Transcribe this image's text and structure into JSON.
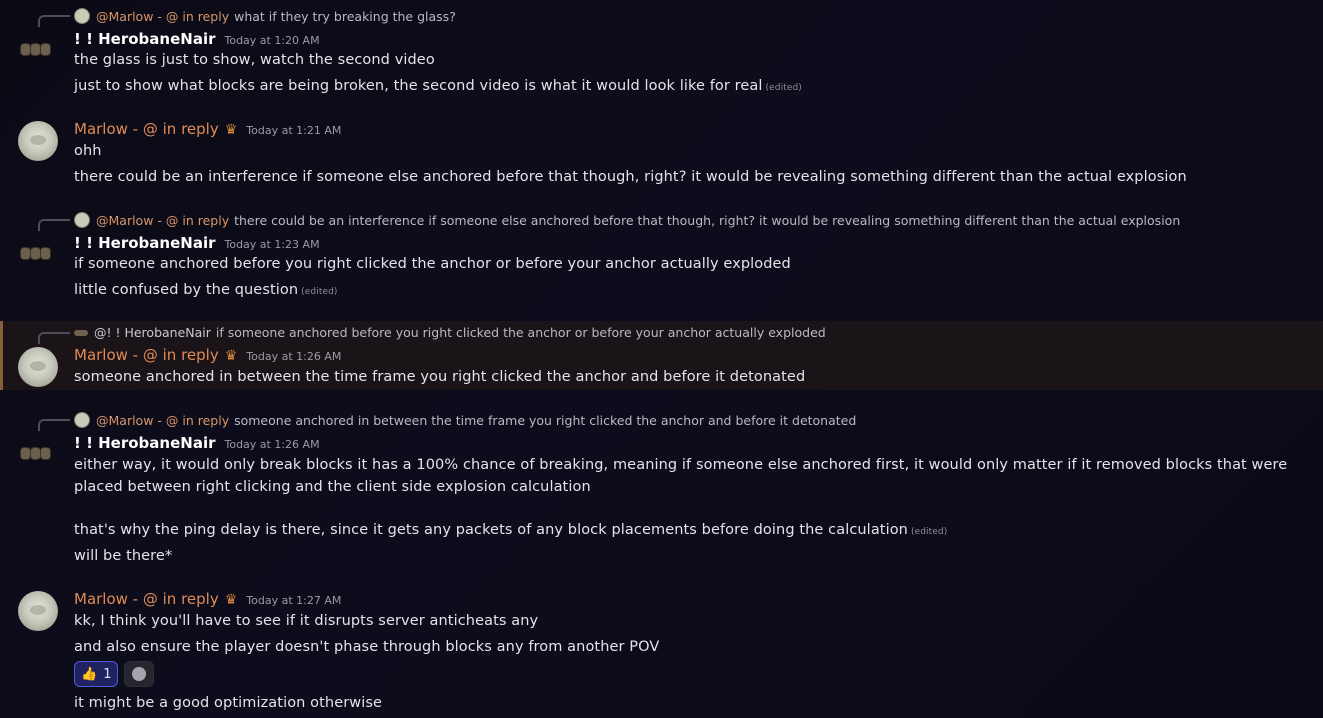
{
  "messages": [
    {
      "reply": {
        "name": "@Marlow - @ in reply",
        "text": "what if they try breaking the glass?"
      },
      "author": "! ! HerobaneNair",
      "time": "Today at 1:20 AM",
      "lines": [
        "the glass is just to show, watch the second video",
        "just to show what blocks are being broken, the second video is what it would look like for real"
      ],
      "edited": "(edited)"
    },
    {
      "author": "Marlow - @ in reply",
      "time": "Today at 1:21 AM",
      "lines": [
        "ohh",
        "there could be an interference if someone else anchored before that though, right? it would be revealing something different than the actual explosion"
      ]
    },
    {
      "reply": {
        "name": "@Marlow - @ in reply",
        "text": "there could be an interference if someone else anchored before that though, right? it would be revealing something different than the actual explosion"
      },
      "author": "! ! HerobaneNair",
      "time": "Today at 1:23 AM",
      "lines": [
        "if someone anchored before you right clicked the anchor or before your anchor actually exploded",
        "little confused by the question"
      ],
      "edited": "(edited)"
    },
    {
      "reply": {
        "name": "@! ! HerobaneNair",
        "text": "if someone anchored before you right clicked the anchor or before your anchor actually exploded"
      },
      "author": "Marlow - @ in reply",
      "time": "Today at 1:26 AM",
      "lines": [
        "someone anchored in between the time frame you right clicked the anchor and before it detonated"
      ]
    },
    {
      "reply": {
        "name": "@Marlow - @ in reply",
        "text": "someone anchored in between the time frame you right clicked the anchor and before it detonated"
      },
      "author": "! ! HerobaneNair",
      "time": "Today at 1:26 AM",
      "lines": [
        "either way, it would only break blocks it has a 100% chance of breaking, meaning if someone else anchored first, it would only matter if it removed blocks that were placed between right clicking and the client side explosion calculation",
        "that's why the ping delay is there, since it gets any packets of any block placements before doing the calculation",
        "will be there*"
      ],
      "edited": "(edited)"
    },
    {
      "author": "Marlow - @ in reply",
      "time": "Today at 1:27 AM",
      "lines": [
        "kk, I think you'll have to see if it disrupts server anticheats any",
        "and also ensure the player doesn't phase through blocks any from another POV",
        "it might be a good optimization otherwise"
      ],
      "reaction": {
        "emoji": "👍",
        "count": "1"
      }
    }
  ]
}
